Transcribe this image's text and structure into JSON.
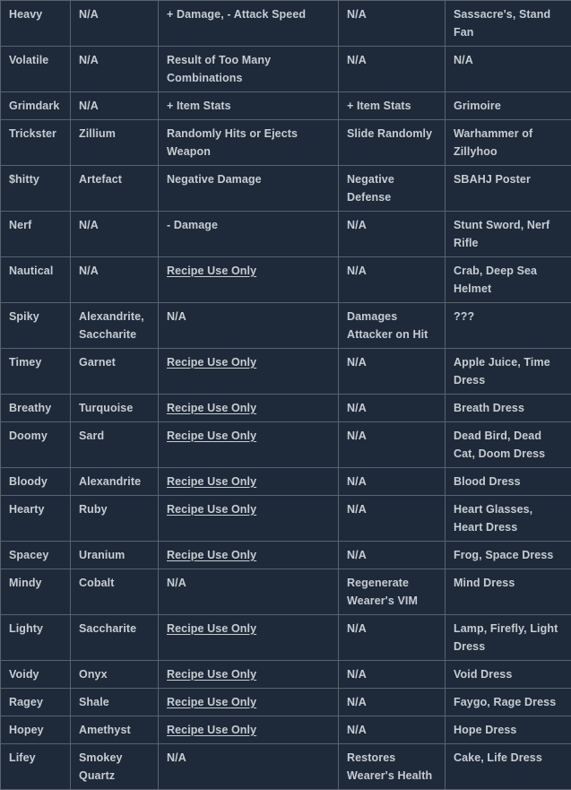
{
  "table": {
    "columns": [
      {
        "key": "abjuration",
        "name": "abjuration-column"
      },
      {
        "key": "mineral",
        "name": "mineral-column"
      },
      {
        "key": "weapon_effect",
        "name": "weapon-effect-column"
      },
      {
        "key": "armor_effect",
        "name": "armor-effect-column"
      },
      {
        "key": "examples",
        "name": "examples-column"
      }
    ],
    "link_label": "Recipe Use Only",
    "na_label": "N/A",
    "rows": [
      {
        "abjuration": "Heavy",
        "mineral": "N/A",
        "weapon_effect": "+ Damage, - Attack Speed",
        "weapon_effect_link": false,
        "armor_effect": "N/A",
        "examples": "Sassacre's, Stand Fan"
      },
      {
        "abjuration": "Volatile",
        "mineral": "N/A",
        "weapon_effect": "Result of Too Many Combinations",
        "weapon_effect_link": false,
        "armor_effect": "N/A",
        "examples": "N/A"
      },
      {
        "abjuration": "Grimdark",
        "mineral": "N/A",
        "weapon_effect": "+ Item Stats",
        "weapon_effect_link": false,
        "armor_effect": "+ Item Stats",
        "examples": "Grimoire"
      },
      {
        "abjuration": "Trickster",
        "mineral": "Zillium",
        "weapon_effect": "Randomly Hits or Ejects Weapon",
        "weapon_effect_link": false,
        "armor_effect": "Slide Randomly",
        "examples": "Warhammer of Zillyhoo"
      },
      {
        "abjuration": "$hitty",
        "mineral": "Artefact",
        "weapon_effect": "Negative Damage",
        "weapon_effect_link": false,
        "armor_effect": "Negative Defense",
        "examples": "SBAHJ Poster"
      },
      {
        "abjuration": "Nerf",
        "mineral": "N/A",
        "weapon_effect": "- Damage",
        "weapon_effect_link": false,
        "armor_effect": "N/A",
        "examples": "Stunt Sword, Nerf Rifle"
      },
      {
        "abjuration": "Nautical",
        "mineral": "N/A",
        "weapon_effect": "Recipe Use Only",
        "weapon_effect_link": true,
        "armor_effect": "N/A",
        "examples": "Crab, Deep Sea Helmet"
      },
      {
        "abjuration": "Spiky",
        "mineral": "Alexandrite, Saccharite",
        "weapon_effect": "N/A",
        "weapon_effect_link": false,
        "armor_effect": "Damages Attacker on Hit",
        "examples": "???"
      },
      {
        "abjuration": "Timey",
        "mineral": "Garnet",
        "weapon_effect": "Recipe Use Only",
        "weapon_effect_link": true,
        "armor_effect": "N/A",
        "examples": "Apple Juice, Time Dress"
      },
      {
        "abjuration": "Breathy",
        "mineral": "Turquoise",
        "weapon_effect": "Recipe Use Only",
        "weapon_effect_link": true,
        "armor_effect": "N/A",
        "examples": "Breath Dress"
      },
      {
        "abjuration": "Doomy",
        "mineral": "Sard",
        "weapon_effect": "Recipe Use Only",
        "weapon_effect_link": true,
        "armor_effect": "N/A",
        "examples": "Dead Bird, Dead Cat, Doom Dress"
      },
      {
        "abjuration": "Bloody",
        "mineral": "Alexandrite",
        "weapon_effect": "Recipe Use Only",
        "weapon_effect_link": true,
        "armor_effect": "N/A",
        "examples": "Blood Dress"
      },
      {
        "abjuration": "Hearty",
        "mineral": "Ruby",
        "weapon_effect": "Recipe Use Only",
        "weapon_effect_link": true,
        "armor_effect": "N/A",
        "examples": "Heart Glasses, Heart Dress"
      },
      {
        "abjuration": "Spacey",
        "mineral": "Uranium",
        "weapon_effect": "Recipe Use Only",
        "weapon_effect_link": true,
        "armor_effect": "N/A",
        "examples": "Frog, Space Dress"
      },
      {
        "abjuration": "Mindy",
        "mineral": "Cobalt",
        "weapon_effect": "N/A",
        "weapon_effect_link": false,
        "armor_effect": "Regenerate Wearer's VIM",
        "examples": "Mind Dress"
      },
      {
        "abjuration": "Lighty",
        "mineral": "Saccharite",
        "weapon_effect": "Recipe Use Only",
        "weapon_effect_link": true,
        "armor_effect": "N/A",
        "examples": "Lamp, Firefly, Light Dress"
      },
      {
        "abjuration": "Voidy",
        "mineral": "Onyx",
        "weapon_effect": "Recipe Use Only",
        "weapon_effect_link": true,
        "armor_effect": "N/A",
        "examples": "Void Dress"
      },
      {
        "abjuration": "Ragey",
        "mineral": "Shale",
        "weapon_effect": "Recipe Use Only",
        "weapon_effect_link": true,
        "armor_effect": "N/A",
        "examples": "Faygo, Rage Dress"
      },
      {
        "abjuration": "Hopey",
        "mineral": "Amethyst",
        "weapon_effect": "Recipe Use Only",
        "weapon_effect_link": true,
        "armor_effect": "N/A",
        "examples": "Hope Dress"
      },
      {
        "abjuration": "Lifey",
        "mineral": "Smokey Quartz",
        "weapon_effect": "N/A",
        "weapon_effect_link": false,
        "armor_effect": "Restores Wearer's Health",
        "examples": "Cake, Life Dress"
      }
    ]
  },
  "theme": {
    "background": "#1e2a3a",
    "page_background": "#1b2736",
    "border": "#59636f",
    "text": "#c7ccd2",
    "link": "#c7ccd2"
  }
}
